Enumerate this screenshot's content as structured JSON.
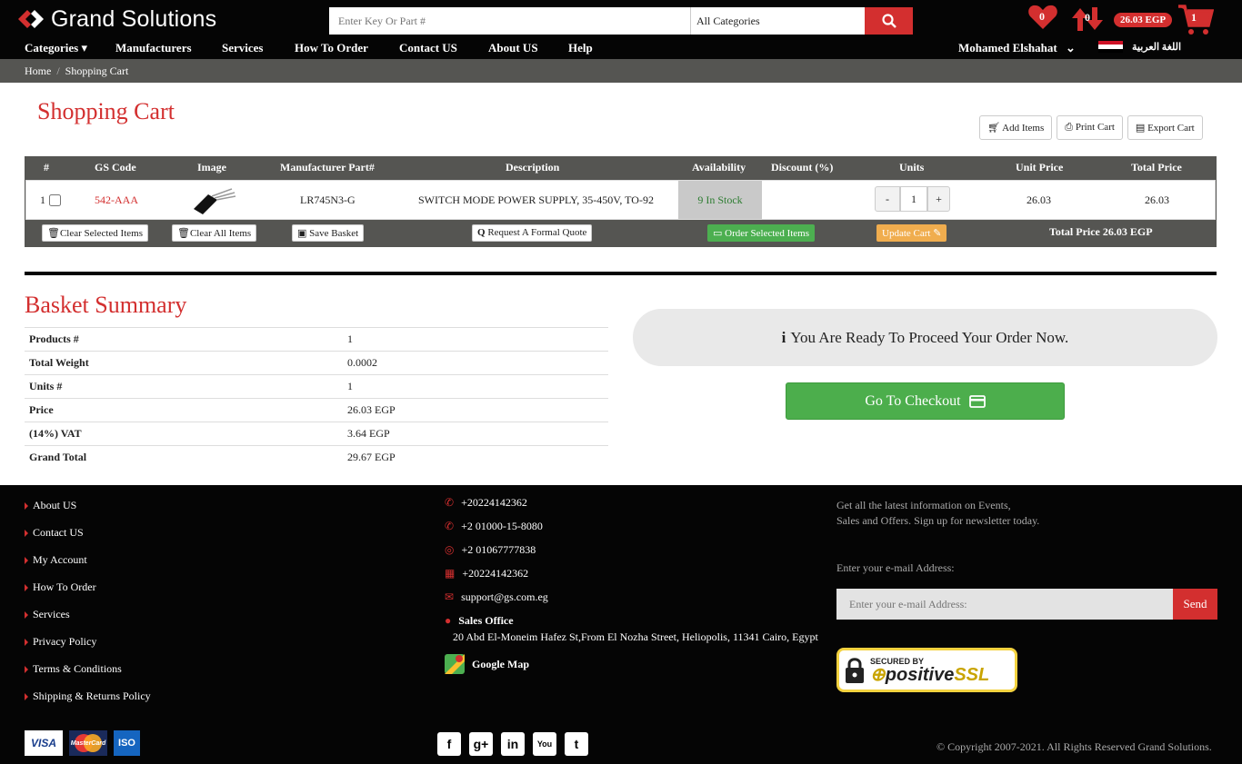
{
  "header": {
    "logo_text": "Grand Solutions",
    "search_placeholder": "Enter Key Or Part #",
    "category_selected": "All Categories",
    "wishlist_count": "0",
    "compare_count": "0",
    "cart_total": "26.03 EGP",
    "cart_count": "1"
  },
  "nav": {
    "items": [
      "Categories",
      "Manufacturers",
      "Services",
      "How To Order",
      "Contact US",
      "About US",
      "Help"
    ],
    "user": "Mohamed Elshahat",
    "language": "اللغة العربية"
  },
  "breadcrumb": [
    "Home",
    "Shopping Cart"
  ],
  "cart": {
    "title": "Shopping Cart",
    "actions": [
      "Add Items",
      "Print Cart",
      "Export Cart"
    ],
    "columns": [
      "#",
      "GS Code",
      "Image",
      "Manufacturer Part#",
      "Description",
      "Availability",
      "Discount (%)",
      "Units",
      "Unit Price",
      "Total Price"
    ],
    "row": {
      "index": "1",
      "gs_code": "542-AAA",
      "mfr_part": "LR745N3-G",
      "description": "SWITCH MODE POWER SUPPLY, 35-450V, TO-92",
      "availability": "9 In Stock",
      "discount": "",
      "units": "1",
      "unit_price": "26.03",
      "total_price": "26.03"
    },
    "buttons": {
      "clear_selected": "Clear Selected Items",
      "clear_all": "Clear All Items",
      "save_basket": "Save Basket",
      "request_quote": "Request A Formal Quote",
      "order_selected": "Order Selected Items",
      "update_cart": "Update Cart"
    },
    "total_line": "Total Price 26.03 EGP"
  },
  "summary": {
    "title": "Basket Summary",
    "rows": [
      {
        "label": "Products #",
        "value": "1"
      },
      {
        "label": "Total Weight",
        "value": "0.0002"
      },
      {
        "label": "Units #",
        "value": "1"
      },
      {
        "label": "Price",
        "value": "26.03 EGP"
      },
      {
        "label": "(14%) VAT",
        "value": "3.64 EGP"
      },
      {
        "label": "Grand Total",
        "value": "29.67 EGP"
      }
    ],
    "ready_text": "You Are Ready To Proceed Your Order Now.",
    "checkout_label": "Go To Checkout"
  },
  "footer": {
    "links": [
      "About US",
      "Contact US",
      "My Account",
      "How To Order",
      "Services",
      "Privacy Policy",
      "Terms & Conditions",
      "Shipping & Returns Policy"
    ],
    "phone1": "+20224142362",
    "phone2": "+2 01000-15-8080",
    "whatsapp": "+2 01067777838",
    "fax": "+20224142362",
    "email": "support@gs.com.eg",
    "office_title": "Sales Office",
    "office_address": "20 Abd El-Moneim Hafez St,From El Nozha Street, Heliopolis, 11341 Cairo, Egypt",
    "map_label": "Google Map",
    "newsletter_text1": "Get all the latest information on Events,",
    "newsletter_text2": "Sales and Offers. Sign up for newsletter today.",
    "email_label": "Enter your e-mail Address:",
    "email_placeholder": "Enter your e-mail Address:",
    "send_label": "Send",
    "ssl_line1": "SECURED BY",
    "ssl_line2a": "positive",
    "ssl_line2b": "SSL",
    "card_visa": "VISA",
    "card_mc": "MasterCard",
    "card_iso": "ISO",
    "copyright": "© Copyright 2007-2021. All Rights Reserved Grand Solutions."
  },
  "colors": {
    "accent": "#d32f2f",
    "success": "#4caf50",
    "warning": "#f0ad4e",
    "header": "#050505",
    "table_header": "#555552"
  }
}
